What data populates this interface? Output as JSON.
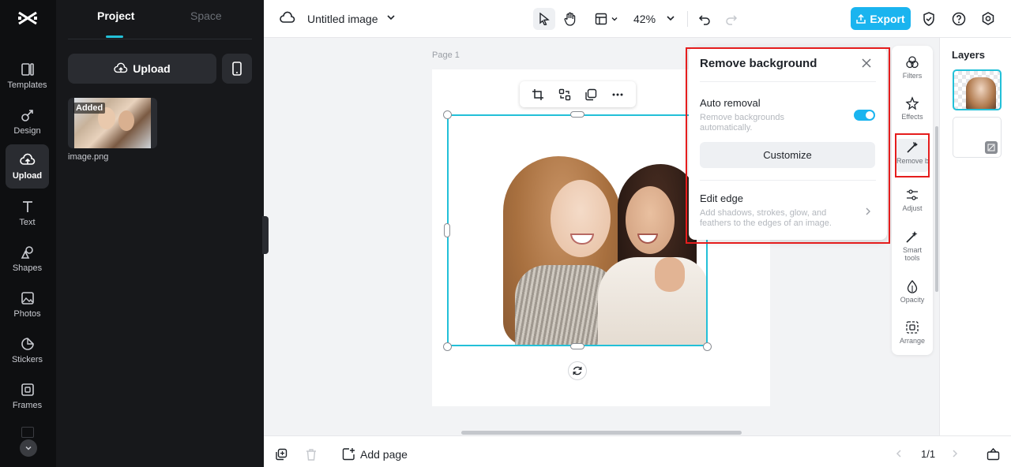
{
  "rail": {
    "items": [
      {
        "label": "Templates",
        "icon": "templates-icon"
      },
      {
        "label": "Design",
        "icon": "design-icon"
      },
      {
        "label": "Upload",
        "icon": "upload-cloud-icon"
      },
      {
        "label": "Text",
        "icon": "text-icon"
      },
      {
        "label": "Shapes",
        "icon": "shapes-icon"
      },
      {
        "label": "Photos",
        "icon": "photos-icon"
      },
      {
        "label": "Stickers",
        "icon": "stickers-icon"
      },
      {
        "label": "Frames",
        "icon": "frames-icon"
      }
    ]
  },
  "panel": {
    "tabs": [
      "Project",
      "Space"
    ],
    "upload_label": "Upload",
    "asset": {
      "badge": "Added",
      "name": "image.png"
    }
  },
  "topbar": {
    "title": "Untitled image",
    "zoom": "42%",
    "export_label": "Export"
  },
  "canvas": {
    "page_label": "Page 1"
  },
  "popup": {
    "title": "Remove background",
    "auto_title": "Auto removal",
    "auto_desc": "Remove backgrounds automatically.",
    "auto_enabled": true,
    "customize_label": "Customize",
    "edge_title": "Edit edge",
    "edge_desc": "Add shadows, strokes, glow, and feathers to the edges of an image."
  },
  "tools": [
    {
      "label": "Filters",
      "icon": "filters-icon"
    },
    {
      "label": "Effects",
      "icon": "effects-icon"
    },
    {
      "label": "Remove backgr...",
      "icon": "remove-background-icon"
    },
    {
      "label": "Adjust",
      "icon": "adjust-icon"
    },
    {
      "label": "Smart tools",
      "icon": "smart-tools-icon"
    },
    {
      "label": "Opacity",
      "icon": "opacity-icon"
    },
    {
      "label": "Arrange",
      "icon": "arrange-icon"
    }
  ],
  "layers": {
    "title": "Layers"
  },
  "bottombar": {
    "add_page_label": "Add page",
    "pagination": "1/1"
  },
  "colors": {
    "accent": "#1ab4ef",
    "selection": "#23c0d8",
    "highlight": "#e51d1d"
  }
}
